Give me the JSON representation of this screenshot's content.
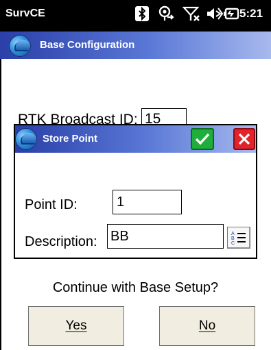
{
  "status_bar": {
    "app_name": "SurvCE",
    "time": "5:21",
    "icons": [
      "bluetooth-icon",
      "gps-icon",
      "no-signal-icon",
      "volume-icon",
      "battery-icon"
    ]
  },
  "base_config": {
    "title": "Base Configuration",
    "rtk_label": "RTK Broadcast ID:",
    "rtk_value": "15"
  },
  "store_point": {
    "title": "Store Point",
    "point_id_label": "Point ID:",
    "point_id_value": "1",
    "description_label": "Description:",
    "description_value": "BB"
  },
  "prompt": {
    "question": "Continue with Base Setup?",
    "yes_label": "Yes",
    "no_label": "No"
  },
  "colors": {
    "title_bar_start": "#2a3fa8",
    "title_bar_end": "#a7b9ee",
    "ok_green": "#1fae3c",
    "cancel_red": "#e3232c",
    "button_face": "#f1ede0"
  }
}
